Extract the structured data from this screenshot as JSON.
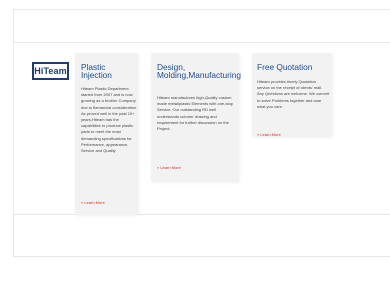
{
  "brand": {
    "logo_text": "HiTeam"
  },
  "cards": [
    {
      "title": "Plastic Injection",
      "body": "Hiteam Plastic Department started from 2007 and is now growing as a brother Company due to flamancial consideration. As proved well in the past 10+ years,Hiteam has the capabilities to produce plastic parts to meet the most demanding specifications for Performance, appearance, Service and Quality",
      "link": "» Learn More"
    },
    {
      "title": "Design, Molding,Manufacturing",
      "body": "Hiteam manufactures high-Quality custom made metal/plastic Elements with one-stop Service. Our outstanding RD well understands cutoms' drawing and requirement for further discussion on the Project.",
      "link": "» Learn More"
    },
    {
      "title": "Free Quotation",
      "body": "Hiteam provides timely Quotation service on the receipt of clients' mail. Any Questions are welcome. We commit to solve Problems together and care what you care.",
      "link": "» Learn More"
    }
  ],
  "colors": {
    "brand_blue": "#1f3d73",
    "title_blue": "#1f4c8a",
    "link_red": "#d0302a",
    "card_bg": "#f2f2f2"
  }
}
